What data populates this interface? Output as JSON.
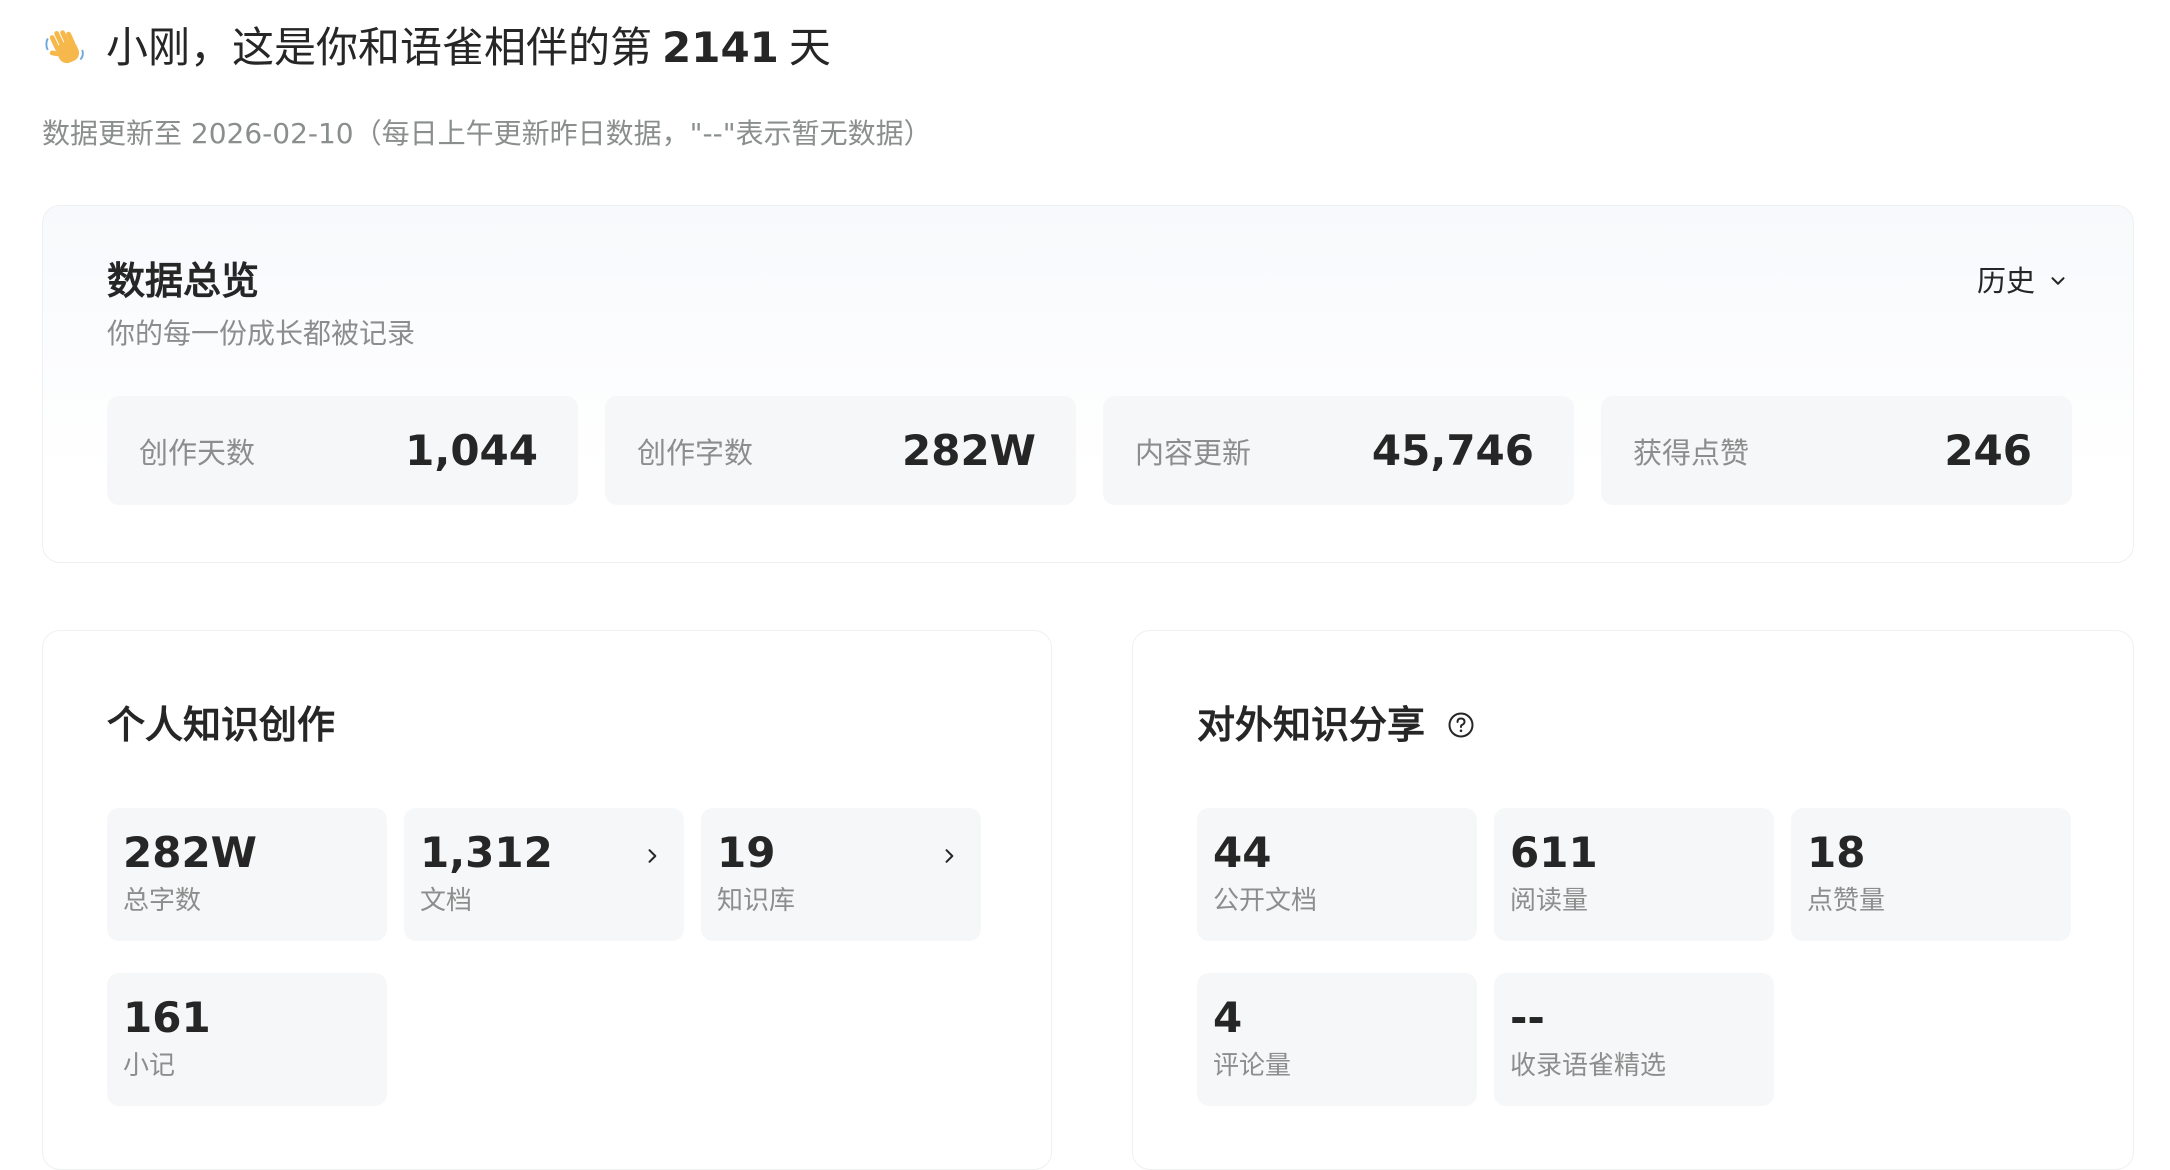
{
  "header": {
    "greeting_prefix": "小刚，这是你和语雀相伴的第",
    "days": "2141",
    "greeting_suffix": "天",
    "subtitle": "数据更新至 2026-02-10（每日上午更新昨日数据，\"--\"表示暂无数据）",
    "wave_icon": "waving-hand-icon"
  },
  "overview": {
    "title": "数据总览",
    "subtitle": "你的每一份成长都被记录",
    "dropdown_label": "历史",
    "stats": [
      {
        "label": "创作天数",
        "value": "1,044"
      },
      {
        "label": "创作字数",
        "value": "282W"
      },
      {
        "label": "内容更新",
        "value": "45,746"
      },
      {
        "label": "获得点赞",
        "value": "246"
      }
    ]
  },
  "personal": {
    "title": "个人知识创作",
    "tiles": [
      {
        "value": "282W",
        "label": "总字数"
      },
      {
        "value": "1,312",
        "label": "文档"
      },
      {
        "value": "19",
        "label": "知识库"
      },
      {
        "value": "161",
        "label": "小记"
      }
    ]
  },
  "sharing": {
    "title": "对外知识分享",
    "tiles": [
      {
        "value": "44",
        "label": "公开文档"
      },
      {
        "value": "611",
        "label": "阅读量"
      },
      {
        "value": "18",
        "label": "点赞量"
      },
      {
        "value": "4",
        "label": "评论量"
      },
      {
        "value": "--",
        "label": "收录语雀精选"
      }
    ]
  },
  "colors": {
    "text_primary": "#262626",
    "text_secondary": "#8a8f8d",
    "tile_background": "#f6f7f8",
    "card_border": "#eff0f0"
  }
}
